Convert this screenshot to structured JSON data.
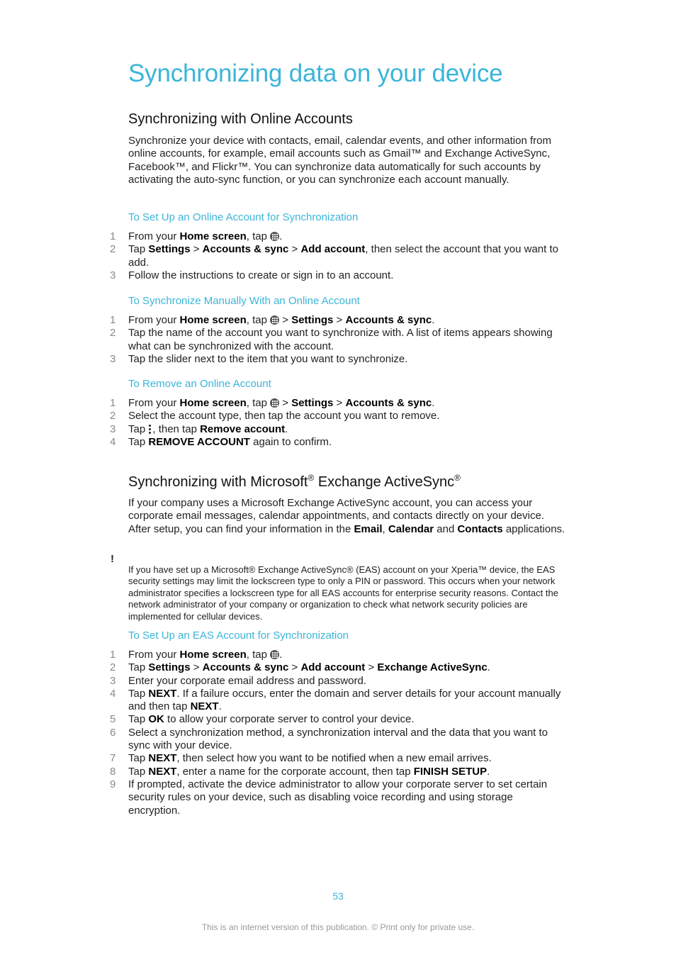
{
  "page": {
    "title": "Synchronizing data on your device",
    "page_number": "53",
    "footer": "This is an internet version of this publication. © Print only for private use."
  },
  "section1": {
    "heading": "Synchronizing with Online Accounts",
    "intro": "Synchronize your device with contacts, email, calendar events, and other information from online accounts, for example, email accounts such as Gmail™ and Exchange ActiveSync, Facebook™, and Flickr™. You can synchronize data automatically for such accounts by activating the auto-sync function, or you can synchronize each account manually.",
    "proc1": {
      "title": "To Set Up an Online Account for Synchronization",
      "steps": [
        {
          "num": "1",
          "parts": [
            "From your ",
            "Home screen",
            ", tap ",
            "."
          ]
        },
        {
          "num": "2",
          "parts": [
            "Tap ",
            "Settings",
            " > ",
            "Accounts & sync",
            " > ",
            "Add account",
            ", then select the account that you want to add."
          ]
        },
        {
          "num": "3",
          "text": "Follow the instructions to create or sign in to an account."
        }
      ]
    },
    "proc2": {
      "title": "To Synchronize Manually With an Online Account",
      "steps": [
        {
          "num": "1",
          "parts": [
            "From your ",
            "Home screen",
            ", tap ",
            " > ",
            "Settings",
            " > ",
            "Accounts & sync",
            "."
          ]
        },
        {
          "num": "2",
          "text": "Tap the name of the account you want to synchronize with. A list of items appears showing what can be synchronized with the account."
        },
        {
          "num": "3",
          "text": "Tap the slider next to the item that you want to synchronize."
        }
      ]
    },
    "proc3": {
      "title": "To Remove an Online Account",
      "steps": [
        {
          "num": "1",
          "parts": [
            "From your ",
            "Home screen",
            ", tap ",
            " > ",
            "Settings",
            " > ",
            "Accounts & sync",
            "."
          ]
        },
        {
          "num": "2",
          "text": "Select the account type, then tap the account you want to remove."
        },
        {
          "num": "3",
          "parts": [
            "Tap ",
            ", then tap ",
            "Remove account",
            "."
          ]
        },
        {
          "num": "4",
          "parts": [
            "Tap ",
            "REMOVE ACCOUNT",
            " again to confirm."
          ]
        }
      ]
    }
  },
  "section2": {
    "heading_a": "Synchronizing with Microsoft",
    "heading_b": " Exchange ActiveSync",
    "reg": "®",
    "intro_parts": [
      "If your company uses a Microsoft Exchange ActiveSync account, you can access your corporate email messages, calendar appointments, and contacts directly on your device. After setup, you can find your information in the ",
      "Email",
      ", ",
      "Calendar",
      " and ",
      "Contacts",
      " applications."
    ],
    "note_icon": "!",
    "note": "If you have set up a Microsoft® Exchange ActiveSync® (EAS) account on your Xperia™ device, the EAS security settings may limit the lockscreen type to only a PIN or password. This occurs when your network administrator specifies a lockscreen type for all EAS accounts for enterprise security reasons. Contact the network administrator of your company or organization to check what network security policies are implemented for cellular devices.",
    "proc": {
      "title": "To Set Up an EAS Account for Synchronization",
      "steps": [
        {
          "num": "1",
          "parts": [
            "From your ",
            "Home screen",
            ", tap ",
            "."
          ]
        },
        {
          "num": "2",
          "parts": [
            "Tap ",
            "Settings",
            " > ",
            "Accounts & sync",
            " > ",
            "Add account",
            " > ",
            "Exchange ActiveSync",
            "."
          ]
        },
        {
          "num": "3",
          "text": "Enter your corporate email address and password."
        },
        {
          "num": "4",
          "parts": [
            "Tap ",
            "NEXT",
            ". If a failure occurs, enter the domain and server details for your account manually and then tap ",
            "NEXT",
            "."
          ]
        },
        {
          "num": "5",
          "parts": [
            "Tap ",
            "OK",
            " to allow your corporate server to control your device."
          ]
        },
        {
          "num": "6",
          "text": "Select a synchronization method, a synchronization interval and the data that you want to sync with your device."
        },
        {
          "num": "7",
          "parts": [
            "Tap ",
            "NEXT",
            ", then select how you want to be notified when a new email arrives."
          ]
        },
        {
          "num": "8",
          "parts": [
            "Tap ",
            "NEXT",
            ", enter a name for the corporate account, then tap ",
            "FINISH SETUP",
            "."
          ]
        },
        {
          "num": "9",
          "text": "If prompted, activate the device administrator to allow your corporate server to set certain security rules on your device, such as disabling voice recording and using storage encryption."
        }
      ]
    }
  }
}
